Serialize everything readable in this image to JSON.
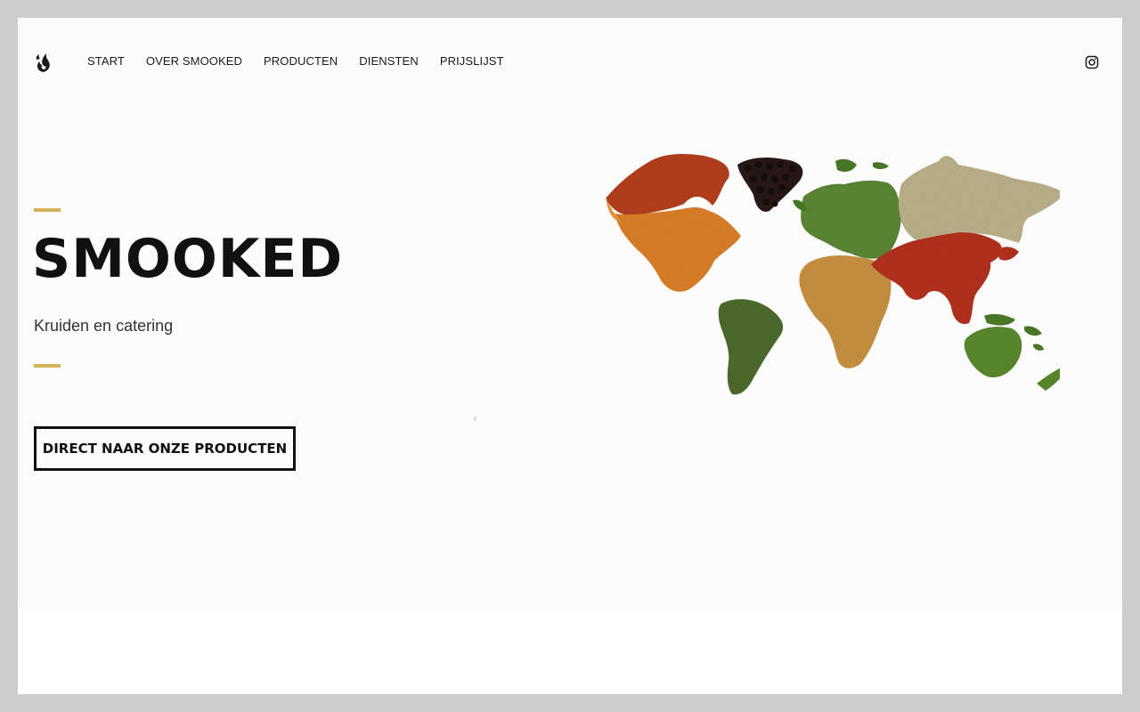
{
  "header": {
    "logo_icon": "flame-logo-icon",
    "nav": [
      "START",
      "OVER SMOOKED",
      "PRODUCTEN",
      "DIENSTEN",
      "PRIJSLIJST"
    ],
    "social_icon": "instagram-icon"
  },
  "hero": {
    "title": "SMOOKED",
    "subtitle": "Kruiden en catering",
    "cta_label": "DIRECT NAAR ONZE PRODUCTEN",
    "accent_color": "#d4b25a",
    "image": "world-map-made-of-spices"
  },
  "colors": {
    "page_frame": "#cdcdcd",
    "hero_background": "#fcfcfc",
    "text": "#111111"
  }
}
